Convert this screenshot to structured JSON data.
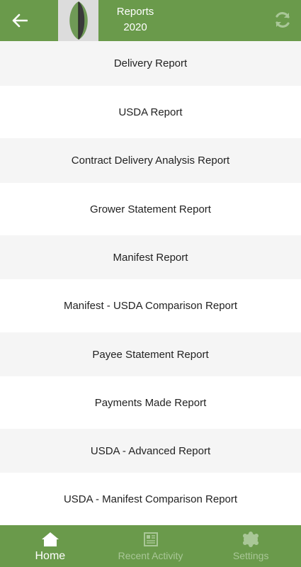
{
  "header": {
    "title": "Reports",
    "year": "2020",
    "back_icon": "arrow-left-icon",
    "refresh_icon": "refresh-icon",
    "color": "#6a9a4b"
  },
  "reports": [
    {
      "label": "Delivery Report"
    },
    {
      "label": "USDA Report"
    },
    {
      "label": "Contract Delivery Analysis Report"
    },
    {
      "label": "Grower Statement Report"
    },
    {
      "label": "Manifest Report"
    },
    {
      "label": "Manifest - USDA Comparison Report"
    },
    {
      "label": "Payee Statement Report"
    },
    {
      "label": "Payments Made Report"
    },
    {
      "label": "USDA - Advanced Report"
    },
    {
      "label": "USDA - Manifest Comparison Report"
    }
  ],
  "bottom_nav": {
    "items": [
      {
        "label": "Home",
        "icon": "home-icon",
        "active": true
      },
      {
        "label": "Recent Activity",
        "icon": "newspaper-icon",
        "active": false
      },
      {
        "label": "Settings",
        "icon": "gear-icon",
        "active": false
      }
    ]
  }
}
